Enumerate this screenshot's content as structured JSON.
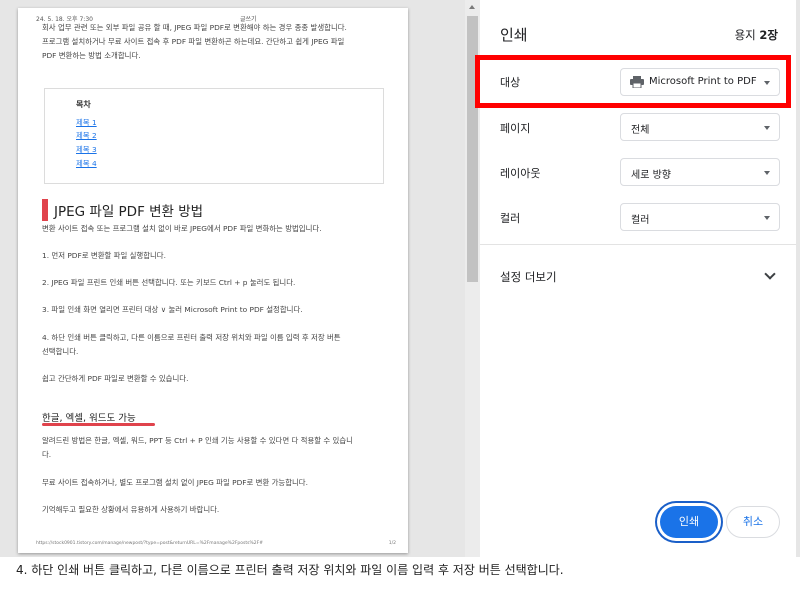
{
  "preview": {
    "header_left": "24. 5. 18. 오후 7:30",
    "header_center": "글쓰기",
    "intro_lines": [
      "회사 업무 관련 또는 외부 파일 공유 할 때, JPEG 파일 PDF로 변환해야 하는 경우 종종 발생합니다.",
      "프로그램 설치하거나 무료 사이트 접속 후 PDF 파일 변환하곤 하는데요. 간단하고 쉽게 JPEG 파일",
      "PDF 변환하는 방법 소개합니다."
    ],
    "toc_title": "목차",
    "toc_items": [
      "제목 1",
      "제목 2",
      "제목 3",
      "제목 4"
    ],
    "heading": "JPEG 파일 PDF 변환 방법",
    "body_lines": [
      "변환 사이트 접속 또는 프로그램 설치 없이 바로 JPEG에서 PDF 파일 변화하는 방법입니다.",
      "1. 먼저 PDF로 변환할 파일 실행합니다.",
      "2. JPEG 파일 프린트 인쇄 버튼 선택합니다. 또는 키보드 Ctrl + p 눌러도 됩니다.",
      "3. 파일 인쇄 화면 열리면 프린터 대상 ∨ 눌러 Microsoft Print to PDF 설정합니다.",
      "4. 하단 인쇄 버튼 클릭하고, 다른 이름으로 프린터 출력 저장 위치와 파일 이름 입력 후 저장 버튼",
      "선택합니다.",
      "쉽고 간단하게 PDF 파일로 변환할 수 있습니다."
    ],
    "subheading": "한글, 엑셀, 워드도 가능",
    "sub_lines": [
      "알려드린 방법은 한글, 엑셀, 워드, PPT 등 Ctrl + P 인쇄 기능 사용할 수 있다면 다 적용할 수 있습니",
      "다.",
      "무료 사이트 접속하거나, 별도 프로그램 설치 없이 JPEG 파일 PDF로 변환 가능합니다.",
      "기억해두고 필요한 상황에서 유용하게 사용하기 바랍니다."
    ],
    "footer_url": "https://stock0901.tistory.com/manage/newpost/?type=post&returnURL=%2Fmanage%2Fposts%2F#",
    "footer_page": "1/2"
  },
  "panel": {
    "title": "인쇄",
    "sheet_prefix": "용지 ",
    "sheet_count": "2장",
    "destination_label": "대상",
    "destination_value": "Microsoft Print to PDF",
    "destination_icon": "printer-icon",
    "pages_label": "페이지",
    "pages_value": "전체",
    "layout_label": "레이아웃",
    "layout_value": "세로 방향",
    "color_label": "컬러",
    "color_value": "컬러",
    "more_settings": "설정 더보기",
    "print_button": "인쇄",
    "cancel_button": "취소",
    "accent_color": "#1a73e8",
    "highlight_color": "#ff0000"
  },
  "caption": "4. 하단 인쇄 버튼 클릭하고, 다른 이름으로 프린터 출력 저장 위치와 파일 이름 입력 후 저장 버튼 선택합니다."
}
